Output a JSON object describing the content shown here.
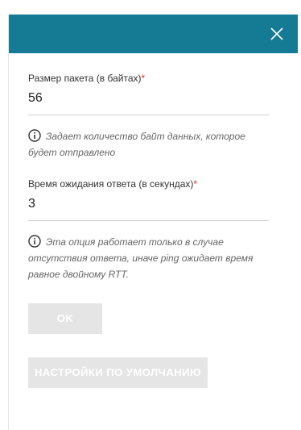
{
  "dialog": {
    "close_icon": "close-icon",
    "header_color": "#157a93"
  },
  "packet_size": {
    "label": "Размер пакета (в байтах)",
    "required_mark": "*",
    "value": "56",
    "hint_icon": "info-icon",
    "hint": "Задает количество байт данных, которое будет отправлено"
  },
  "timeout": {
    "label": "Время ожидания ответа (в секундах)",
    "required_mark": "*",
    "value": "3",
    "hint_icon": "info-icon",
    "hint": "Эта опция работает только в случае отсутствия ответа, иначе ping ожидает время равное двойному RTT."
  },
  "buttons": {
    "ok_label": "OK",
    "default_label": "НАСТРОЙКИ ПО УМОЛЧАНИЮ"
  }
}
